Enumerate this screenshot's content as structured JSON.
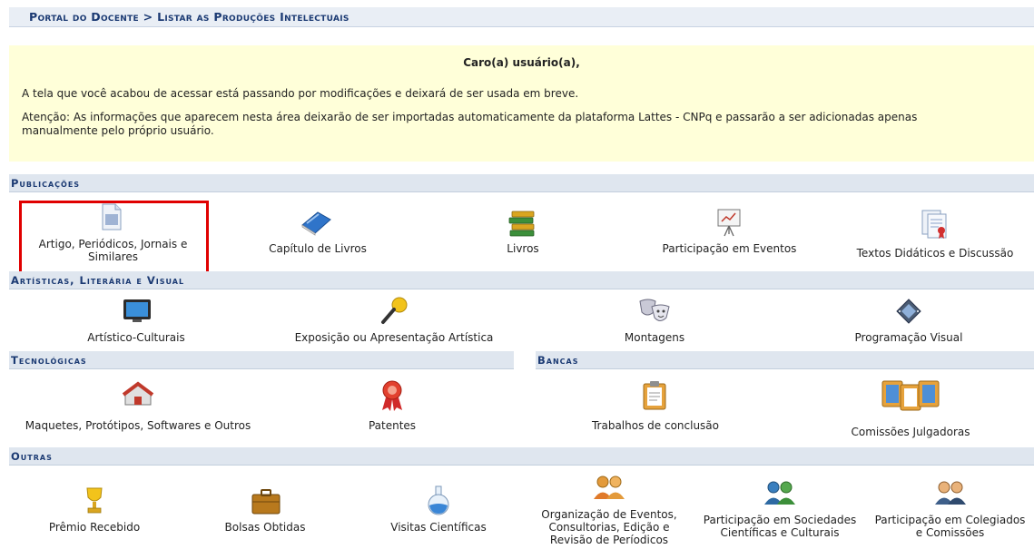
{
  "breadcrumb": "Portal do Docente > Listar as Produções Intelectuais",
  "notice": {
    "title": "Caro(a) usuário(a),",
    "line1": "A tela que você acabou de acessar está passando por modificações e deixará de ser usada em breve.",
    "line2a": "Atenção: As informações que aparecem nesta área deixarão de ser importadas automaticamente da plataforma Lattes - CNPq e passarão a ser adicionadas apenas",
    "line2b": "manualmente pelo próprio usuário."
  },
  "sections": {
    "publicacoes": "Publicações",
    "artisticas": "Artísticas, Literária e Visual",
    "tecnologicas": "Tecnológicas",
    "bancas": "Bancas",
    "outras": "Outras"
  },
  "items": {
    "artigo1": "Artigo, Periódicos, Jornais e",
    "artigo2": "Similares",
    "capitulo": "Capítulo de Livros",
    "livros": "Livros",
    "eventos": "Participação em Eventos",
    "textos": "Textos Didáticos e Discussão",
    "artistico": "Artístico-Culturais",
    "exposicao": "Exposição ou Apresentação Artística",
    "montagens": "Montagens",
    "programacao": "Programação Visual",
    "maquetes": "Maquetes, Protótipos, Softwares e Outros",
    "patentes": "Patentes",
    "trabalhos": "Trabalhos de conclusão",
    "comissoes": "Comissões Julgadoras",
    "premio": "Prêmio Recebido",
    "bolsas": "Bolsas Obtidas",
    "visitas": "Visitas Científicas",
    "organizacao1": "Organização de Eventos,",
    "organizacao2": "Consultorias, Edição e",
    "organizacao3": "Revisão de Períodicos",
    "sociedades1": "Participação em Sociedades",
    "sociedades2": "Científicas e Culturais",
    "colegiados1": "Participação em Colegiados",
    "colegiados2": "e Comissões"
  }
}
